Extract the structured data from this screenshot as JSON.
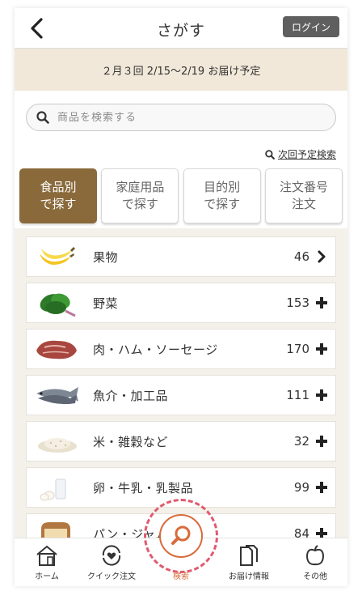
{
  "header": {
    "title": "さがす",
    "login_label": "ログイン"
  },
  "delivery": {
    "text": "２月３回 2/15〜2/19 お届け予定"
  },
  "search": {
    "placeholder": "商品を検索する",
    "next_search_label": "次回予定検索"
  },
  "tabs": [
    {
      "line1": "食品別",
      "line2": "で探す",
      "active": true
    },
    {
      "line1": "家庭用品",
      "line2": "で探す",
      "active": false
    },
    {
      "line1": "目的別",
      "line2": "で探す",
      "active": false
    },
    {
      "line1": "注文番号",
      "line2": "注文",
      "active": false
    }
  ],
  "categories": [
    {
      "name": "果物",
      "count": "46",
      "mark": "chevron-right-icon",
      "thumb": "banana-icon"
    },
    {
      "name": "野菜",
      "count": "153",
      "mark": "plus-icon",
      "thumb": "spinach-icon"
    },
    {
      "name": "肉・ハム・ソーセージ",
      "count": "170",
      "mark": "plus-icon",
      "thumb": "meat-icon"
    },
    {
      "name": "魚介・加工品",
      "count": "111",
      "mark": "plus-icon",
      "thumb": "fish-icon"
    },
    {
      "name": "米・雑穀など",
      "count": "32",
      "mark": "plus-icon",
      "thumb": "rice-icon"
    },
    {
      "name": "卵・牛乳・乳製品",
      "count": "99",
      "mark": "plus-icon",
      "thumb": "milk-egg-icon"
    },
    {
      "name": "パン・ジャム",
      "count": "84",
      "mark": "plus-icon",
      "thumb": "bread-icon"
    }
  ],
  "tabbar": {
    "home": "ホーム",
    "quick": "クイック注文",
    "search": "検索",
    "delivery_info": "お届け情報",
    "other": "その他"
  },
  "colors": {
    "accent_brown": "#8a6a3b",
    "accent_orange": "#d86b3b",
    "highlight_dash": "#e05a6e"
  }
}
